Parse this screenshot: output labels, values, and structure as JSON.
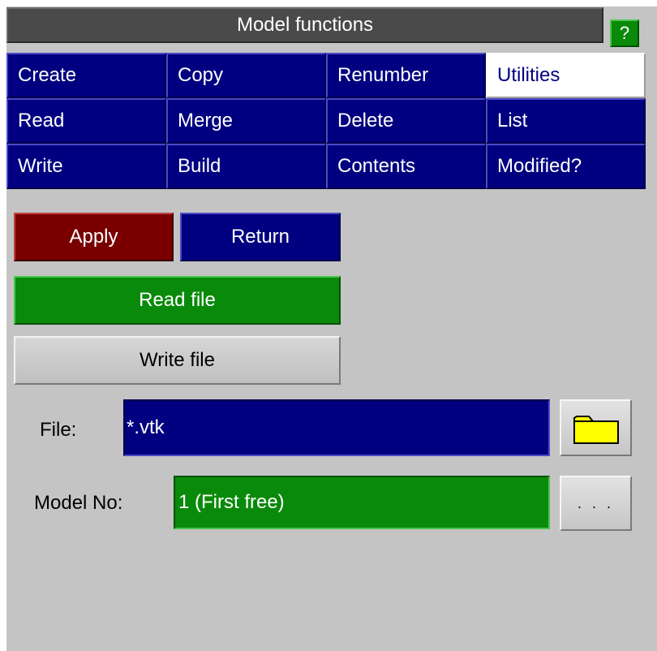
{
  "header": {
    "title": "Model functions",
    "help_label": "?"
  },
  "menu": {
    "items": [
      {
        "label": "Create"
      },
      {
        "label": "Copy"
      },
      {
        "label": "Renumber"
      },
      {
        "label": "Utilities",
        "active": true
      },
      {
        "label": "Read"
      },
      {
        "label": "Merge"
      },
      {
        "label": "Delete"
      },
      {
        "label": "List"
      },
      {
        "label": "Write"
      },
      {
        "label": "Build"
      },
      {
        "label": "Contents"
      },
      {
        "label": "Modified?"
      }
    ]
  },
  "actions": {
    "apply_label": "Apply",
    "return_label": "Return",
    "read_file_label": "Read file",
    "write_file_label": "Write file"
  },
  "file": {
    "label": "File:",
    "value": "*.vtk",
    "browse_icon": "folder-icon"
  },
  "model": {
    "label": "Model No:",
    "value": "1 (First free)",
    "more_label": ". . ."
  },
  "colors": {
    "panel_bg": "#c4c4c4",
    "menu_blue": "#000080",
    "apply_red": "#7a0000",
    "active_green": "#0a8a0a",
    "folder_yellow": "#ffff00"
  }
}
